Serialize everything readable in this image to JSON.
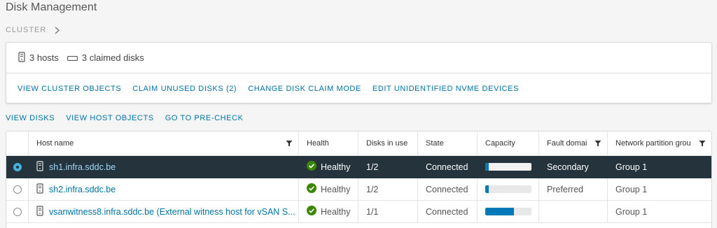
{
  "page": {
    "title": "Disk Management"
  },
  "breadcrumb": {
    "items": [
      "CLUSTER"
    ]
  },
  "summary": {
    "hosts_label": "3 hosts",
    "disks_label": "3 claimed disks",
    "actions": [
      "VIEW CLUSTER OBJECTS",
      "CLAIM UNUSED DISKS (2)",
      "CHANGE DISK CLAIM MODE",
      "EDIT UNIDENTIFIED NVME DEVICES"
    ]
  },
  "view_actions": [
    "VIEW DISKS",
    "VIEW HOST OBJECTS",
    "GO TO PRE-CHECK"
  ],
  "grid": {
    "columns": {
      "host": "Host name",
      "health": "Health",
      "disks": "Disks in use",
      "state": "State",
      "capacity": "Capacity",
      "fault": "Fault domai",
      "network": "Network partition grou"
    },
    "rows": [
      {
        "host": "sh1.infra.sddc.be",
        "health": "Healthy",
        "disks": "1/2",
        "state": "Connected",
        "capacity_fraction": 0.08,
        "fault": "Secondary",
        "network": "Group 1",
        "selected": true
      },
      {
        "host": "sh2.infra.sddc.be",
        "health": "Healthy",
        "disks": "1/2",
        "state": "Connected",
        "capacity_fraction": 0.08,
        "fault": "Preferred",
        "network": "Group 1",
        "selected": false
      },
      {
        "host": "vsanwitness8.infra.sddc.be (External witness host for vSAN S...",
        "health": "Healthy",
        "disks": "1/1",
        "state": "Connected",
        "capacity_fraction": 0.62,
        "fault": "",
        "network": "Group 1",
        "selected": false
      }
    ]
  },
  "colors": {
    "accent_link": "#0072a3",
    "healthy": "#3c8500",
    "selected_row_bg": "#25333d",
    "capacity_fill": "#0079b8"
  },
  "icons": [
    "chevron-right-icon",
    "server-icon",
    "disk-icon",
    "filter-icon",
    "check-circle-icon"
  ]
}
